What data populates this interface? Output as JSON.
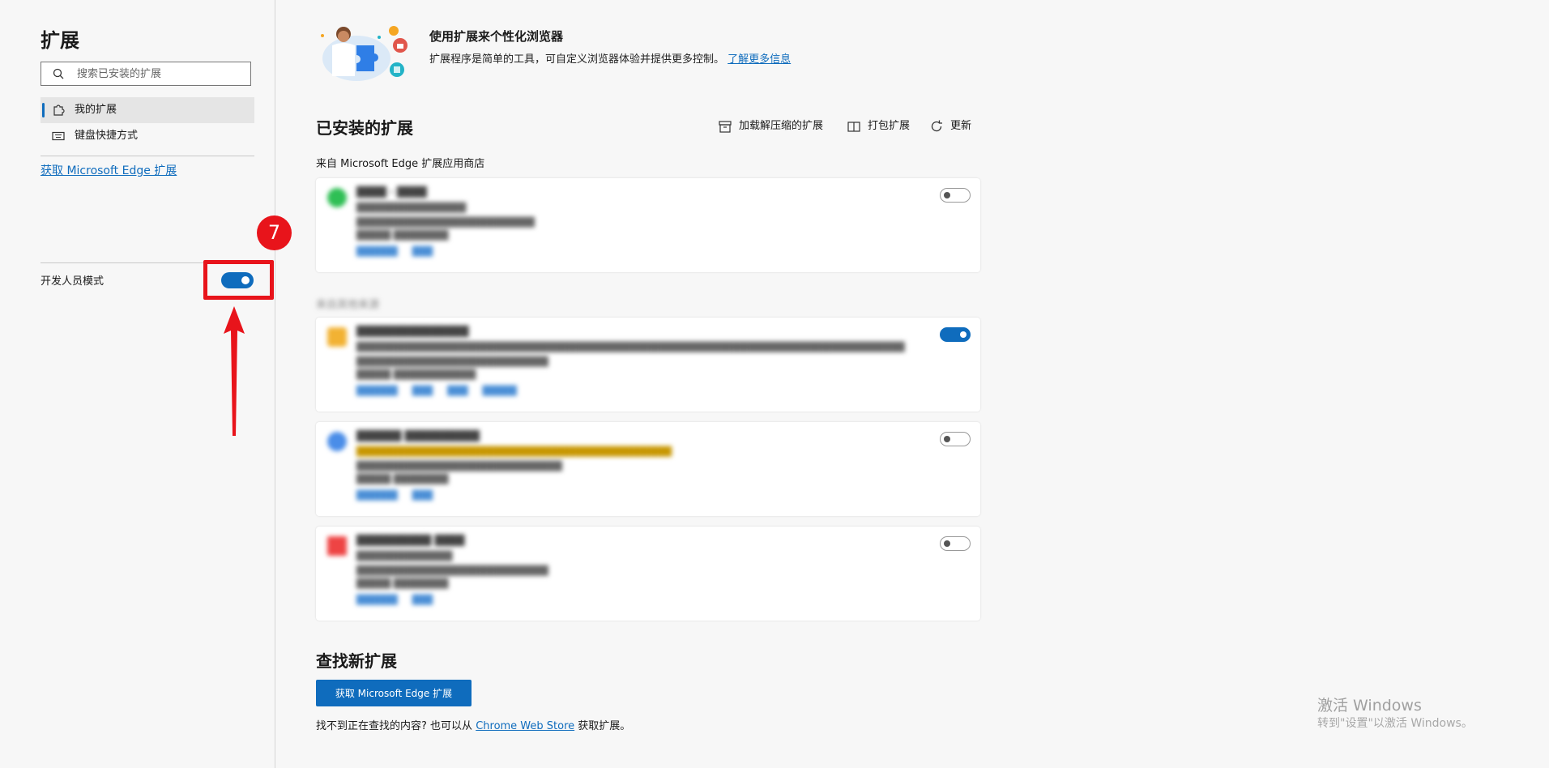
{
  "sidebar": {
    "title": "扩展",
    "search_placeholder": "搜索已安装的扩展",
    "nav": [
      {
        "label": "我的扩展",
        "active": true
      },
      {
        "label": "键盘快捷方式",
        "active": false
      }
    ],
    "get_extensions_link": "获取 Microsoft Edge 扩展",
    "dev_mode_label": "开发人员模式",
    "dev_mode_on": true
  },
  "annotation": {
    "step_number": "7",
    "color": "#e8141b"
  },
  "banner": {
    "title": "使用扩展来个性化浏览器",
    "description": "扩展程序是简单的工具，可自定义浏览器体验并提供更多控制。",
    "learn_more": "了解更多信息"
  },
  "installed": {
    "heading": "已安装的扩展",
    "actions": {
      "load_unpacked": "加载解压缩的扩展",
      "pack": "打包扩展",
      "update": "更新"
    },
    "store_section": "来自 Microsoft Edge 扩展应用商店",
    "other_section": "来自其他来源"
  },
  "find": {
    "heading": "查找新扩展",
    "button": "获取 Microsoft Edge 扩展",
    "footer_prefix": "找不到正在查找的内容? 也可以从",
    "chrome_store_link": "Chrome Web Store",
    "footer_suffix": "获取扩展。"
  },
  "watermark": {
    "title": "激活 Windows",
    "subtitle": "转到\"设置\"以激活 Windows。"
  },
  "colors": {
    "accent": "#0f6cbd",
    "annotation_red": "#e8141b"
  }
}
